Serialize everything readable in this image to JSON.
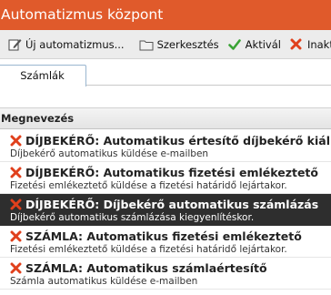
{
  "window": {
    "title": "Automatizmus központ"
  },
  "toolbar": {
    "new_label": "Új automatizmus...",
    "edit_label": "Szerkesztés",
    "activate_label": "Aktivál",
    "deactivate_label": "Inaktivál"
  },
  "tabs": [
    {
      "label": "Számlák",
      "active": true
    }
  ],
  "grid": {
    "column_header": "Megnevezés",
    "rows": [
      {
        "name": "DÍJBEKÉRŐ: Automatikus értesítő díjbekérő kiállításáról",
        "description": "Díjbekérő automatikus küldése e-mailben",
        "status_icon": "inactive-x-icon",
        "selected": false
      },
      {
        "name": "DÍJBEKÉRŐ: Automatikus fizetési emlékeztető",
        "description": "Fizetési emlékeztető küldése a fizetési határidő lejártakor.",
        "status_icon": "inactive-x-icon",
        "selected": false
      },
      {
        "name": "DÍJBEKÉRŐ: Díjbekérő automatikus számlázás",
        "description": "Díjbekérő automatikus számlázása kiegyenlítéskor.",
        "status_icon": "inactive-x-icon",
        "selected": true
      },
      {
        "name": "SZÁMLA: Automatikus fizetési emlékeztető",
        "description": "Fizetési emlékeztető küldése a fizetési határidő lejártakor.",
        "status_icon": "inactive-x-icon",
        "selected": false
      },
      {
        "name": "SZÁMLA: Automatikus számlaértesítő",
        "description": "Számla automatikus küldése e-mailben",
        "status_icon": "inactive-x-icon",
        "selected": false
      }
    ]
  },
  "colors": {
    "title_bar": "#e05a2b",
    "selected_row": "#2e2e2e",
    "inactive_x": "#e0401c",
    "activate_check": "#3aa335"
  }
}
